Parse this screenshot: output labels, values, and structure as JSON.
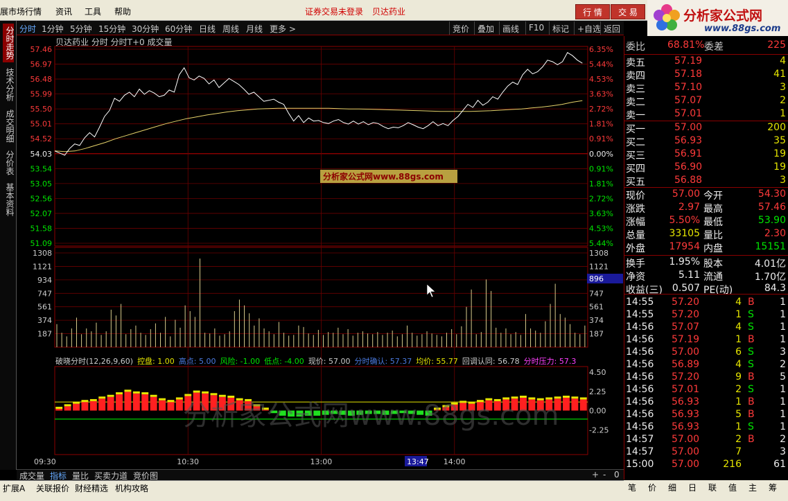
{
  "menubar": {
    "title": "展市场行情",
    "menus": [
      "资讯",
      "工具",
      "帮助"
    ],
    "status": "证券交易未登录",
    "stock": "贝达药业",
    "btn_quote": "行 情",
    "btn_trade": "交 易"
  },
  "logo": {
    "title": "分析家公式网",
    "url": "www.88gs.com"
  },
  "left_tabs": [
    "分时走势",
    "技术分析",
    "成交明细",
    "分价表",
    "基本资料"
  ],
  "toolbar": {
    "periods": [
      "分时",
      "1分钟",
      "5分钟",
      "15分钟",
      "30分钟",
      "60分钟",
      "日线",
      "周线",
      "月线",
      "更多 >"
    ],
    "right": [
      "竞价",
      "叠加",
      "画线",
      "F10",
      "标记",
      "+自选",
      "返回"
    ]
  },
  "chart": {
    "header": "贝达药业  分时 分时T+0 成交量",
    "watermark_small": "分析家公式网www.88gs.com",
    "watermark_big": "分析家公式网www.88gs.com",
    "price_labels": [
      "57.46",
      "56.97",
      "56.48",
      "55.99",
      "55.50",
      "55.01",
      "54.52",
      "54.03",
      "53.54",
      "53.05",
      "52.56",
      "52.07",
      "51.58",
      "51.09"
    ],
    "pct_labels": [
      "6.35%",
      "5.44%",
      "4.53%",
      "3.63%",
      "2.72%",
      "1.81%",
      "0.91%",
      "0.00%",
      "0.91%",
      "1.81%",
      "2.72%",
      "3.63%",
      "4.53%",
      "5.44%"
    ],
    "vol_labels": [
      "1308",
      "1121",
      "934",
      "747",
      "561",
      "374",
      "187"
    ],
    "vol_cursor": "896",
    "indicator_header": [
      {
        "t": "破晓分时(12,26,9,60)",
        "c": "#cccccc"
      },
      {
        "t": "控盘: 1.00",
        "c": "#e6e600"
      },
      {
        "t": "高点: 5.00",
        "c": "#4a7ae0"
      },
      {
        "t": "风险: -1.00",
        "c": "#00e600"
      },
      {
        "t": "低点: -4.00",
        "c": "#00e600"
      },
      {
        "t": "现价: 57.00",
        "c": "#cccccc"
      },
      {
        "t": "分时确认: 57.37",
        "c": "#4a7ae0"
      },
      {
        "t": "均价: 55.77",
        "c": "#e6e600"
      },
      {
        "t": "回调认同: 56.78",
        "c": "#cccccc"
      },
      {
        "t": "分时压力: 57.3",
        "c": "#ff40ff"
      }
    ],
    "ind_labels": [
      "4.50",
      "2.25",
      "0.00",
      "-2.25"
    ],
    "time_labels": [
      "09:30",
      "10:30",
      "13:00",
      "14:00"
    ],
    "time_cursor": "13:47"
  },
  "chart_data": {
    "type": "line",
    "price_line": [
      54.12,
      54.05,
      53.98,
      54.2,
      54.35,
      54.3,
      54.55,
      54.72,
      54.58,
      54.9,
      55.25,
      55.45,
      55.85,
      55.75,
      55.95,
      56.05,
      55.9,
      56.15,
      55.98,
      56.1,
      56.02,
      55.9,
      55.95,
      56.12,
      56.05,
      56.62,
      56.85,
      56.52,
      56.45,
      56.58,
      56.5,
      56.32,
      56.45,
      56.2,
      56.35,
      56.5,
      56.4,
      56.3,
      56.15,
      55.98,
      56.05,
      55.9,
      55.75,
      55.78,
      55.82,
      55.72,
      55.65,
      55.35,
      55.1,
      55.28,
      55.05,
      55.2,
      55.1,
      55.12,
      55.05,
      55.02,
      55.1,
      55.15,
      55.05,
      55.0,
      55.1,
      55.0,
      55.08,
      54.98,
      55.05,
      55.02,
      54.92,
      54.85,
      54.9,
      54.88,
      54.95,
      55.05,
      54.98,
      54.9,
      54.85,
      54.95,
      55.08,
      54.95,
      55.02,
      54.95,
      55.12,
      55.25,
      55.45,
      55.65,
      55.55,
      55.78,
      55.62,
      55.72,
      55.9,
      55.82,
      56.05,
      56.25,
      56.38,
      56.3,
      56.62,
      56.8,
      56.65,
      56.72,
      56.88,
      57.1,
      57.05,
      56.95,
      57.05,
      57.35,
      57.25,
      57.1,
      57.0
    ],
    "avg_line": [
      54.12,
      54.1,
      54.12,
      54.2,
      54.3,
      54.4,
      54.52,
      54.62,
      54.72,
      54.82,
      54.92,
      55.02,
      55.1,
      55.18,
      55.24,
      55.3,
      55.35,
      55.4,
      55.44,
      55.47,
      55.5,
      55.51,
      55.52,
      55.52,
      55.52,
      55.52,
      55.52,
      55.52,
      55.51,
      55.5,
      55.5,
      55.49,
      55.48,
      55.47,
      55.46,
      55.45,
      55.44,
      55.43,
      55.42,
      55.42,
      55.42,
      55.42,
      55.43,
      55.44,
      55.46,
      55.48,
      55.5,
      55.53,
      55.56,
      55.6,
      55.65,
      55.72,
      55.77
    ],
    "volume": [
      320,
      200,
      150,
      260,
      410,
      180,
      260,
      220,
      340,
      170,
      220,
      520,
      440,
      600,
      180,
      250,
      300,
      200,
      170,
      250,
      330,
      200,
      420,
      150,
      380,
      270,
      580,
      500,
      420,
      1230,
      200,
      190,
      260,
      160,
      180,
      220,
      500,
      660,
      580,
      470,
      300,
      400,
      260,
      220,
      180,
      350,
      200,
      160,
      170,
      300,
      280,
      190,
      170,
      240,
      170,
      210,
      200,
      270,
      180,
      250,
      160,
      200,
      220,
      190,
      180,
      210,
      170,
      200,
      230,
      150,
      180,
      300,
      200,
      160,
      180,
      220,
      190,
      170,
      150,
      200,
      250,
      180,
      290,
      560,
      800,
      180,
      210,
      940,
      780,
      270,
      200,
      260,
      180,
      210,
      170,
      460,
      260,
      230,
      200,
      360,
      600,
      880,
      460,
      410,
      320,
      200,
      180,
      300
    ],
    "indicator": [
      0.2,
      0.5,
      0.8,
      1.0,
      1.1,
      1.4,
      1.6,
      1.9,
      2.2,
      2.0,
      1.9,
      1.6,
      1.2,
      1.0,
      1.3,
      1.7,
      2.1,
      2.0,
      1.8,
      1.6,
      1.5,
      1.2,
      1.1,
      0.5,
      0.1,
      -0.3,
      -0.6,
      -0.7,
      -0.7,
      -0.6,
      -0.6,
      -0.5,
      -0.4,
      -0.5,
      -0.6,
      -0.5,
      -0.4,
      -0.4,
      -0.5,
      -0.4,
      -0.3,
      -0.4,
      -0.5,
      -0.6,
      0.1,
      0.4,
      0.7,
      0.9,
      0.8,
      1.0,
      1.2,
      1.1,
      1.3,
      1.4,
      1.5,
      1.3,
      1.2,
      1.3,
      1.4,
      1.5,
      1.4,
      1.3
    ],
    "ylim": [
      51.09,
      57.46
    ],
    "prev_close": 54.03
  },
  "quote": {
    "weibi_label": "委比",
    "weibi": "68.81%",
    "weicha_label": "委差",
    "weicha": "225",
    "sells": [
      {
        "l": "卖五",
        "p": "57.19",
        "v": "4"
      },
      {
        "l": "卖四",
        "p": "57.18",
        "v": "41"
      },
      {
        "l": "卖三",
        "p": "57.10",
        "v": "3"
      },
      {
        "l": "卖二",
        "p": "57.07",
        "v": "2"
      },
      {
        "l": "卖一",
        "p": "57.01",
        "v": "1"
      }
    ],
    "buys": [
      {
        "l": "买一",
        "p": "57.00",
        "v": "200"
      },
      {
        "l": "买二",
        "p": "56.93",
        "v": "35"
      },
      {
        "l": "买三",
        "p": "56.91",
        "v": "19"
      },
      {
        "l": "买四",
        "p": "56.90",
        "v": "19"
      },
      {
        "l": "买五",
        "p": "56.88",
        "v": "3"
      }
    ],
    "stats": [
      {
        "l1": "现价",
        "v1": "57.00",
        "c1": "red",
        "l2": "今开",
        "v2": "54.30",
        "c2": "red"
      },
      {
        "l1": "涨跌",
        "v1": "2.97",
        "c1": "red",
        "l2": "最高",
        "v2": "57.46",
        "c2": "red"
      },
      {
        "l1": "涨幅",
        "v1": "5.50%",
        "c1": "red",
        "l2": "最低",
        "v2": "53.90",
        "c2": "grn"
      },
      {
        "l1": "总量",
        "v1": "33105",
        "c1": "yel",
        "l2": "量比",
        "v2": "2.30",
        "c2": "red"
      },
      {
        "l1": "外盘",
        "v1": "17954",
        "c1": "red",
        "l2": "内盘",
        "v2": "15151",
        "c2": "grn"
      }
    ],
    "fin": [
      {
        "l1": "换手",
        "v1": "1.95%",
        "l2": "股本",
        "v2": "4.01亿"
      },
      {
        "l1": "净资",
        "v1": "5.11",
        "l2": "流通",
        "v2": "1.70亿"
      },
      {
        "l1": "收益(三)",
        "v1": "0.507",
        "l2": "PE(动)",
        "v2": "84.3"
      }
    ],
    "ticks": [
      {
        "t": "14:55",
        "p": "57.20",
        "v": "4",
        "d": "B",
        "n": "1"
      },
      {
        "t": "14:55",
        "p": "57.20",
        "v": "1",
        "d": "S",
        "n": "1"
      },
      {
        "t": "14:56",
        "p": "57.07",
        "v": "4",
        "d": "S",
        "n": "1"
      },
      {
        "t": "14:56",
        "p": "57.19",
        "v": "1",
        "d": "B",
        "n": "1"
      },
      {
        "t": "14:56",
        "p": "57.00",
        "v": "6",
        "d": "S",
        "n": "3"
      },
      {
        "t": "14:56",
        "p": "56.89",
        "v": "4",
        "d": "S",
        "n": "2"
      },
      {
        "t": "14:56",
        "p": "57.20",
        "v": "9",
        "d": "B",
        "n": "5"
      },
      {
        "t": "14:56",
        "p": "57.01",
        "v": "2",
        "d": "S",
        "n": "1"
      },
      {
        "t": "14:56",
        "p": "56.93",
        "v": "1",
        "d": "B",
        "n": "1"
      },
      {
        "t": "14:56",
        "p": "56.93",
        "v": "5",
        "d": "B",
        "n": "1"
      },
      {
        "t": "14:56",
        "p": "56.93",
        "v": "1",
        "d": "S",
        "n": "1"
      },
      {
        "t": "14:57",
        "p": "57.00",
        "v": "2",
        "d": "B",
        "n": "2"
      },
      {
        "t": "14:57",
        "p": "57.00",
        "v": "7",
        "d": "",
        "n": "3"
      },
      {
        "t": "15:00",
        "p": "57.00",
        "v": "216",
        "d": "",
        "n": "61"
      }
    ]
  },
  "bottom_tabs": [
    "成交量",
    "指标",
    "量比",
    "买卖力道",
    "竞价图"
  ],
  "bottom_ctrl": [
    "+",
    "-",
    "0"
  ],
  "status_tabs": [
    "扩展A",
    "关联报价",
    "财经精选",
    "机构攻略"
  ],
  "right_tabs": [
    "笔",
    "价",
    "细",
    "日",
    "联",
    "值",
    "主",
    "筹"
  ]
}
